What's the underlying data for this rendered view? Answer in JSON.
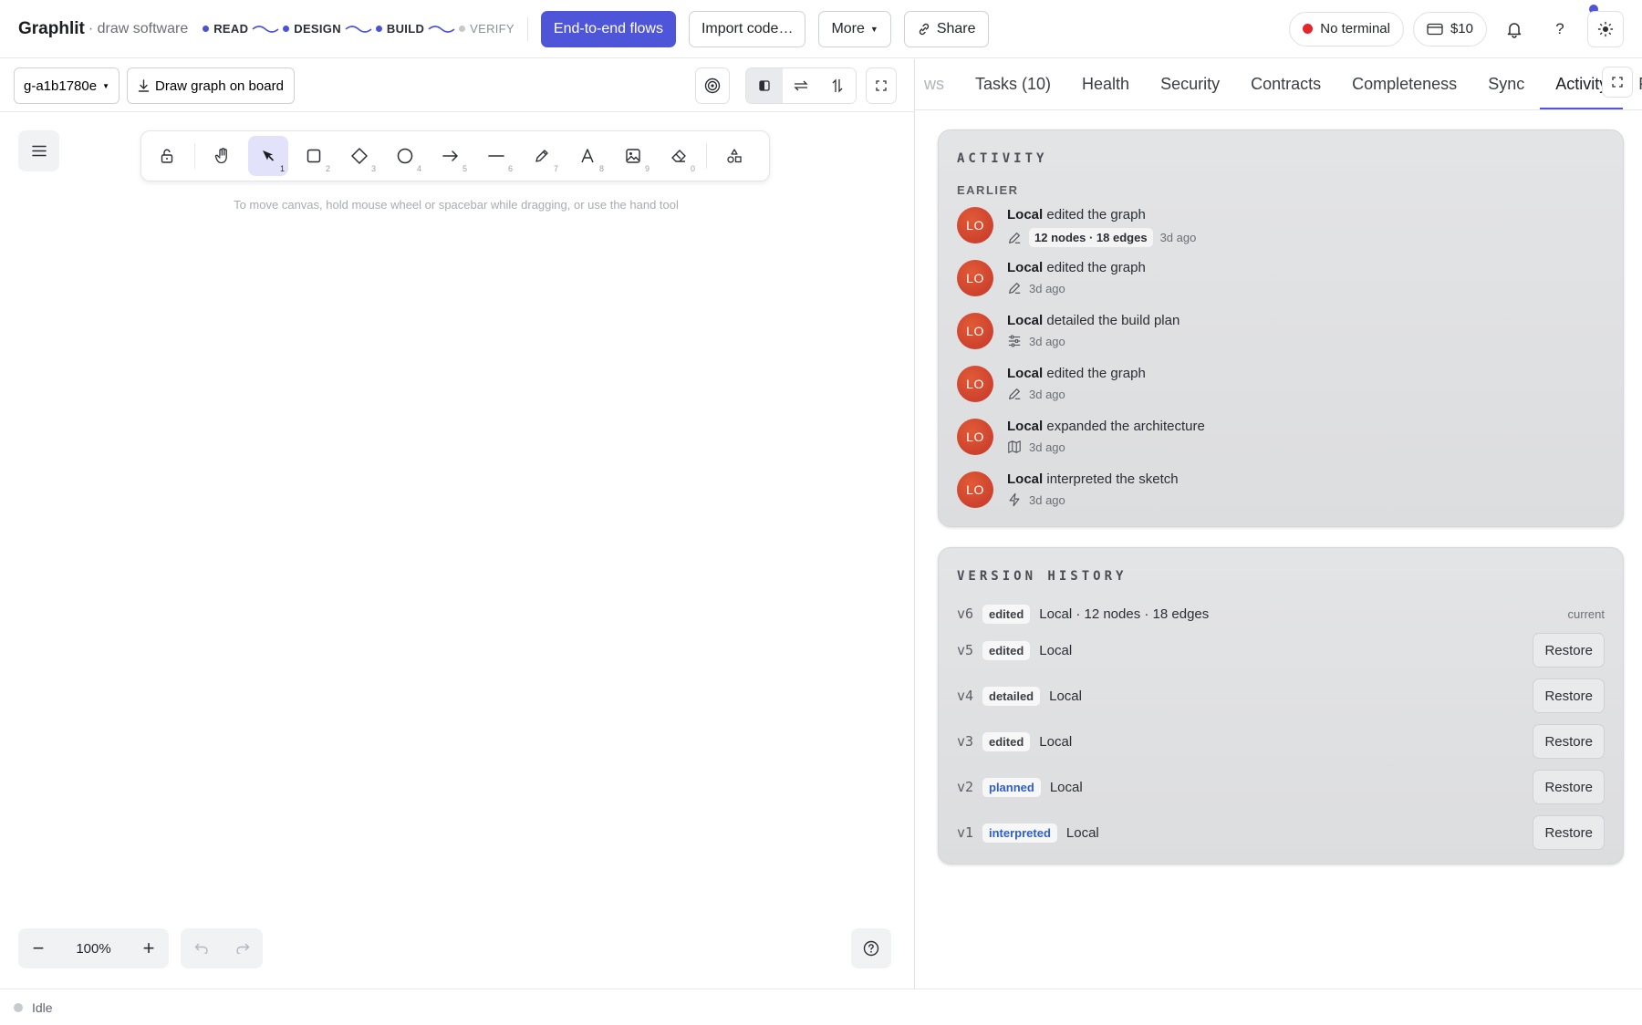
{
  "header": {
    "brand": "Graphlit",
    "brand_sub": "· draw software",
    "steps": [
      "READ",
      "DESIGN",
      "BUILD",
      "VERIFY"
    ],
    "flows_button": "End-to-end flows",
    "import_button": "Import code…",
    "more_button": "More",
    "share_button": "Share",
    "terminal_status": "No terminal",
    "balance": "$10",
    "help_label": "?"
  },
  "canvas": {
    "graph_id": "g-a1b1780e",
    "draw_button": "Draw graph on board",
    "hint": "To move canvas, hold mouse wheel or spacebar while dragging, or use the hand tool",
    "zoom": "100%",
    "tool_numbers": [
      "1",
      "2",
      "3",
      "4",
      "5",
      "6",
      "7",
      "8",
      "9",
      "0"
    ]
  },
  "status": {
    "text": "Idle"
  },
  "panel": {
    "tabs": [
      {
        "label": "ws"
      },
      {
        "label": "Tasks (10)"
      },
      {
        "label": "Health"
      },
      {
        "label": "Security"
      },
      {
        "label": "Contracts"
      },
      {
        "label": "Completeness"
      },
      {
        "label": "Sync"
      },
      {
        "label": "Activity"
      },
      {
        "label": "P"
      }
    ],
    "activity": {
      "title": "ACTIVITY",
      "section": "EARLIER",
      "items": [
        {
          "avatar": "LO",
          "user": "Local",
          "action": "edited the graph",
          "chip": "12 nodes · 18 edges",
          "time": "3d ago",
          "icon": "pencil-icon"
        },
        {
          "avatar": "LO",
          "user": "Local",
          "action": "edited the graph",
          "time": "3d ago",
          "icon": "pencil-icon"
        },
        {
          "avatar": "LO",
          "user": "Local",
          "action": "detailed the build plan",
          "time": "3d ago",
          "icon": "sliders-icon"
        },
        {
          "avatar": "LO",
          "user": "Local",
          "action": "edited the graph",
          "time": "3d ago",
          "icon": "pencil-icon"
        },
        {
          "avatar": "LO",
          "user": "Local",
          "action": "expanded the architecture",
          "time": "3d ago",
          "icon": "map-icon"
        },
        {
          "avatar": "LO",
          "user": "Local",
          "action": "interpreted the sketch",
          "time": "3d ago",
          "icon": "bolt-icon"
        }
      ]
    },
    "versions": {
      "title": "VERSION HISTORY",
      "current_label": "current",
      "restore_label": "Restore",
      "items": [
        {
          "v": "v6",
          "badge": "edited",
          "text": "Local · 12 nodes · 18 edges"
        },
        {
          "v": "v5",
          "badge": "edited",
          "text": "Local"
        },
        {
          "v": "v4",
          "badge": "detailed",
          "text": "Local"
        },
        {
          "v": "v3",
          "badge": "edited",
          "text": "Local"
        },
        {
          "v": "v2",
          "badge": "planned",
          "text": "Local"
        },
        {
          "v": "v1",
          "badge": "interpreted",
          "text": "Local"
        }
      ]
    }
  },
  "colors": {
    "accent": "#4f55d8",
    "avatar": "#d2432e",
    "terminal_dot": "#e5252c"
  }
}
